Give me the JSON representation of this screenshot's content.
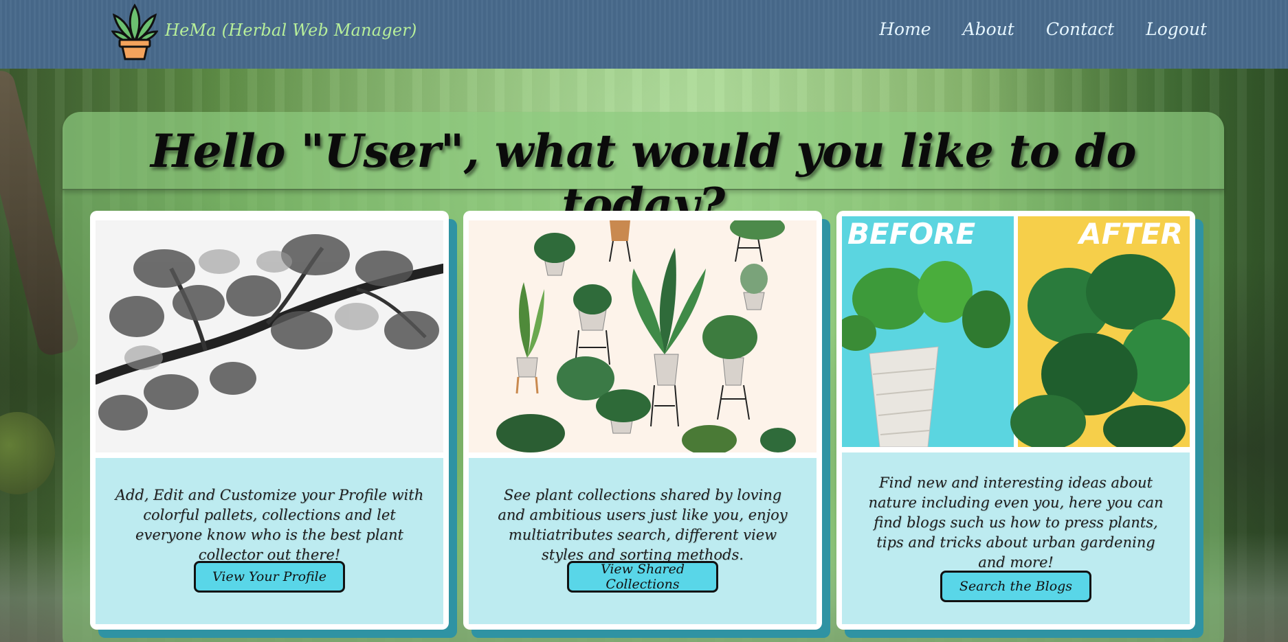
{
  "app": {
    "brand": "HeMa (Herbal Web Manager)"
  },
  "nav": {
    "items": [
      {
        "label": "Home"
      },
      {
        "label": "About"
      },
      {
        "label": "Contact"
      },
      {
        "label": "Logout"
      }
    ]
  },
  "main": {
    "headline": "Hello \"User\", what would you like to do today?",
    "cards": [
      {
        "image": "sketched-oak-branch",
        "text": "Add, Edit and Customize your Profile with colorful pallets, collections and let everyone know who is the best plant collector out there!",
        "button": "View Your Profile"
      },
      {
        "image": "potted-plants-collection",
        "text": "See plant collections shared by loving and ambitious users just like you, enjoy multiatributes search, different view styles and sorting methods.",
        "button": "View Shared Collections"
      },
      {
        "image": "monstera-before-after",
        "before_label": "BEFORE",
        "after_label": "AFTER",
        "text": "Find new and interesting ideas about nature including even you, here you can find blogs such us how to press plants, tips and tricks about urban gardening and more!",
        "button": "Search the Blogs"
      }
    ]
  },
  "colors": {
    "navbar": "#47698b",
    "brand_text": "#b7ef9a",
    "card_body": "#bdebf0",
    "button": "#59d6e8",
    "card_shadow": "#2f93a3"
  }
}
